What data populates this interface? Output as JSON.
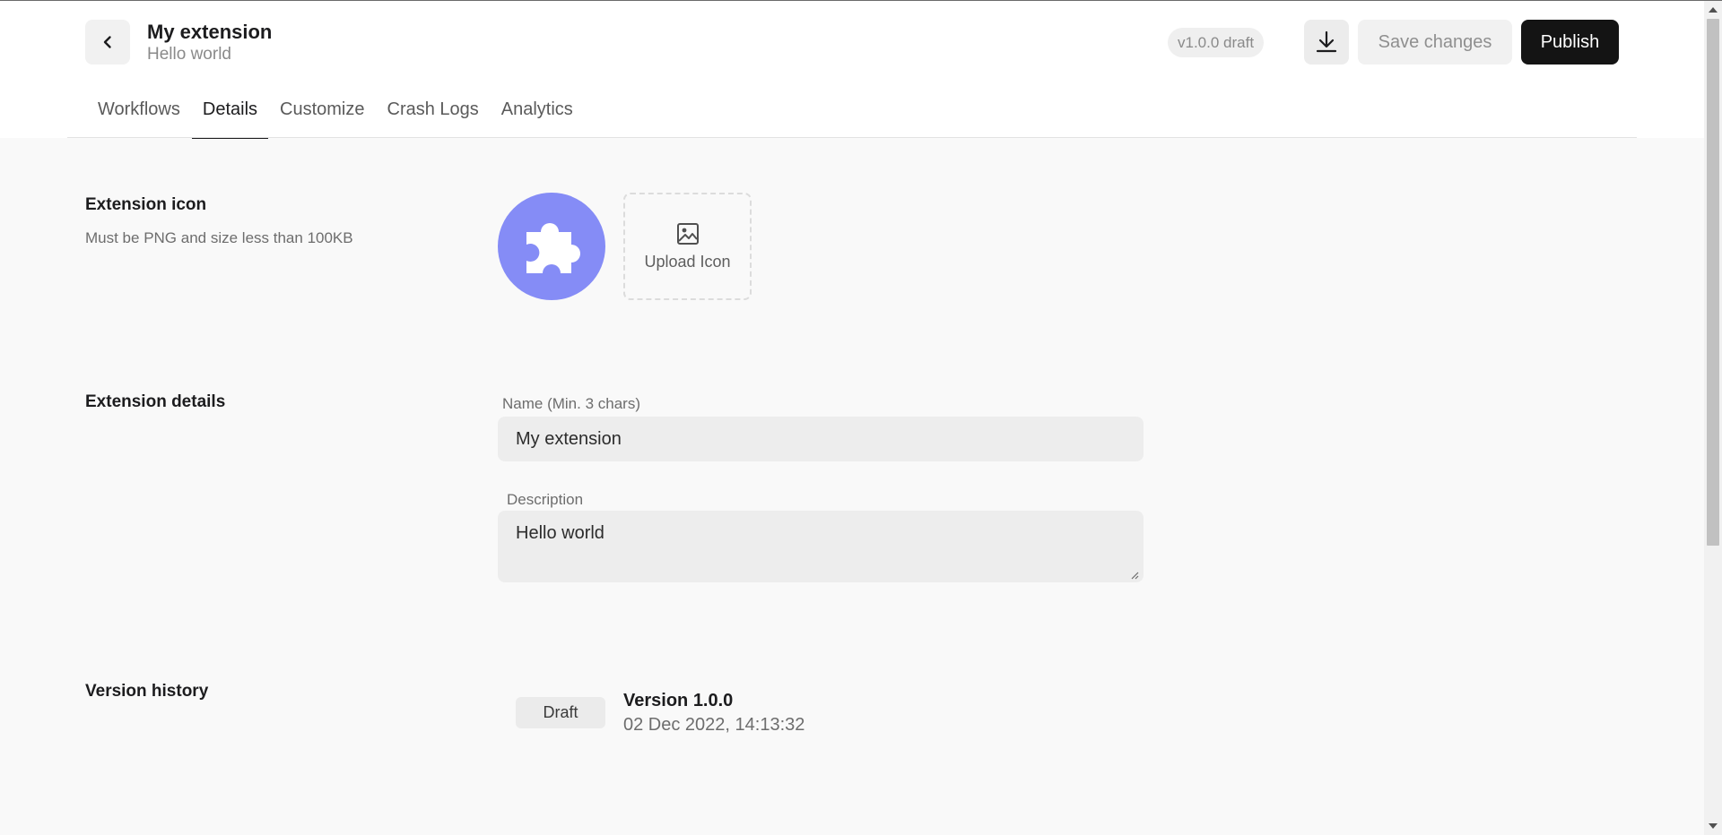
{
  "header": {
    "back_icon": "chevron-left-icon",
    "title": "My extension",
    "subtitle": "Hello world",
    "version_badge": "v1.0.0 draft",
    "download_icon": "download-icon",
    "save_label": "Save changes",
    "publish_label": "Publish"
  },
  "tabs": [
    {
      "label": "Workflows",
      "active": false
    },
    {
      "label": "Details",
      "active": true
    },
    {
      "label": "Customize",
      "active": false
    },
    {
      "label": "Crash Logs",
      "active": false
    },
    {
      "label": "Analytics",
      "active": false
    }
  ],
  "icon_section": {
    "title": "Extension icon",
    "help": "Must be PNG and size less than 100KB",
    "icon": "puzzle-piece-icon",
    "icon_color": "#858cf6",
    "upload_label": "Upload Icon",
    "upload_icon": "image-icon"
  },
  "details_section": {
    "title": "Extension details",
    "name_label": "Name (Min. 3 chars)",
    "name_value": "My extension",
    "description_label": "Description",
    "description_value": "Hello world"
  },
  "history_section": {
    "title": "Version history",
    "versions": [
      {
        "status": "Draft",
        "name": "Version 1.0.0",
        "date": "02 Dec 2022, 14:13:32"
      }
    ]
  },
  "colors": {
    "accent": "#141414",
    "background": "#f9f9f9"
  }
}
